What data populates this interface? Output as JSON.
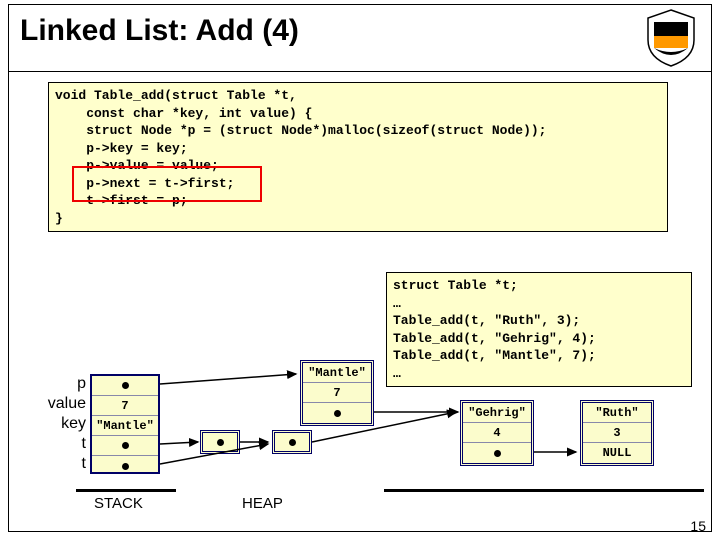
{
  "title": "Linked List: Add (4)",
  "code_main": "void Table_add(struct Table *t,\n    const char *key, int value) {\n    struct Node *p = (struct Node*)malloc(sizeof(struct Node));\n    p->key = key;\n    p->value = value;\n    p->next = t->first;\n    t->first = p;\n}",
  "code_usage": "struct Table *t;\n…\nTable_add(t, \"Ruth\", 3);\nTable_add(t, \"Gehrig\", 4);\nTable_add(t, \"Mantle\", 7);\n…",
  "stack": {
    "labels": [
      "p",
      "value",
      "key",
      "t",
      "t"
    ],
    "value": "7",
    "key": "\"Mantle\""
  },
  "heap": {
    "mantle": {
      "key": "\"Mantle\"",
      "value": "7"
    },
    "gehrig": {
      "key": "\"Gehrig\"",
      "value": "4"
    },
    "ruth": {
      "key": "\"Ruth\"",
      "value": "3",
      "next": "NULL"
    }
  },
  "labels": {
    "stack": "STACK",
    "heap": "HEAP"
  },
  "pagenum": "15"
}
